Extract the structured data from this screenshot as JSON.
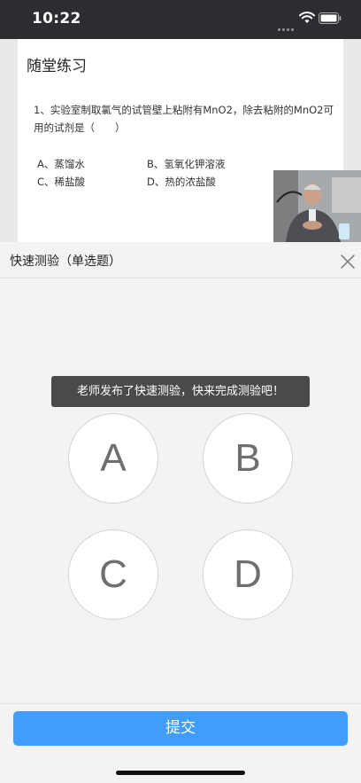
{
  "status_bar": {
    "time": "10:22"
  },
  "slide": {
    "title": "随堂练习",
    "question": "1、实验室制取氯气的试管壁上粘附有MnO2，除去粘附的MnO2可用的试剂是（　　）",
    "options": [
      "A、蒸馏水",
      "B、氢氧化钾溶液",
      "C、稀盐酸",
      "D、热的浓盐酸"
    ]
  },
  "quiz": {
    "title": "快速测验（单选题）",
    "toast": "老师发布了快速测验，快来完成测验吧！",
    "choices": [
      "A",
      "B",
      "C",
      "D"
    ],
    "submit_label": "提交"
  },
  "colors": {
    "accent": "#3f9dfb",
    "status_bar_bg": "#2b2d30",
    "toast_bg": "#4a4a4a"
  }
}
